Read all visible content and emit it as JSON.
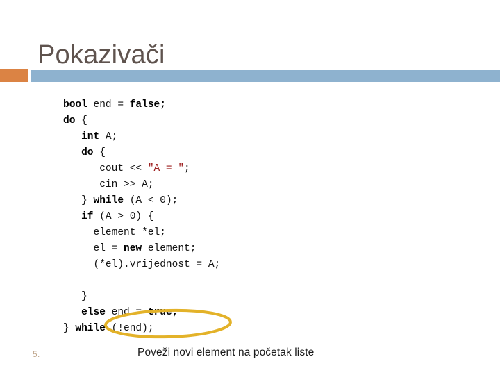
{
  "slide": {
    "title": "Pokazivači",
    "list_marker": "5.",
    "accent": {
      "square_color": "#db8344",
      "bar_color": "#8eb2cf",
      "title_color": "#5f534e"
    }
  },
  "code": {
    "language": "cpp",
    "lines": [
      [
        {
          "t": "bool",
          "s": "kw"
        },
        {
          "t": " end = ",
          "s": "plain"
        },
        {
          "t": "false;",
          "s": "kw"
        }
      ],
      [
        {
          "t": "do",
          "s": "kw"
        },
        {
          "t": " {",
          "s": "plain"
        }
      ],
      [
        {
          "t": "   ",
          "s": "plain"
        },
        {
          "t": "int",
          "s": "kw"
        },
        {
          "t": " A;",
          "s": "plain"
        }
      ],
      [
        {
          "t": "   ",
          "s": "plain"
        },
        {
          "t": "do",
          "s": "kw"
        },
        {
          "t": " {",
          "s": "plain"
        }
      ],
      [
        {
          "t": "      cout << ",
          "s": "plain"
        },
        {
          "t": "\"A = \"",
          "s": "str"
        },
        {
          "t": ";",
          "s": "plain"
        }
      ],
      [
        {
          "t": "      cin >> A;",
          "s": "plain"
        }
      ],
      [
        {
          "t": "   } ",
          "s": "plain"
        },
        {
          "t": "while",
          "s": "kw"
        },
        {
          "t": " (A < 0);",
          "s": "plain"
        }
      ],
      [
        {
          "t": "   ",
          "s": "plain"
        },
        {
          "t": "if",
          "s": "kw"
        },
        {
          "t": " (A > 0) {",
          "s": "plain"
        }
      ],
      [
        {
          "t": "     element *el;",
          "s": "plain"
        }
      ],
      [
        {
          "t": "     el = ",
          "s": "plain"
        },
        {
          "t": "new",
          "s": "kw"
        },
        {
          "t": " element;",
          "s": "plain"
        }
      ],
      [
        {
          "t": "     (*el).vrijednost = A;",
          "s": "plain"
        }
      ],
      [
        {
          "t": "",
          "s": "plain"
        }
      ],
      [
        {
          "t": "   }",
          "s": "plain"
        }
      ],
      [
        {
          "t": "   ",
          "s": "plain"
        },
        {
          "t": "else",
          "s": "kw"
        },
        {
          "t": " end = ",
          "s": "plain"
        },
        {
          "t": "true;",
          "s": "kw"
        }
      ],
      [
        {
          "t": "} ",
          "s": "plain"
        },
        {
          "t": "while",
          "s": "kw"
        },
        {
          "t": " (!end);",
          "s": "plain"
        }
      ]
    ]
  },
  "prose": {
    "note": "Poveži novi element na početak liste"
  },
  "annotation": {
    "name": "ellipse-highlight",
    "stroke_color": "#e3b229",
    "stroke_width": 4,
    "targets_line": "el = new element;"
  }
}
